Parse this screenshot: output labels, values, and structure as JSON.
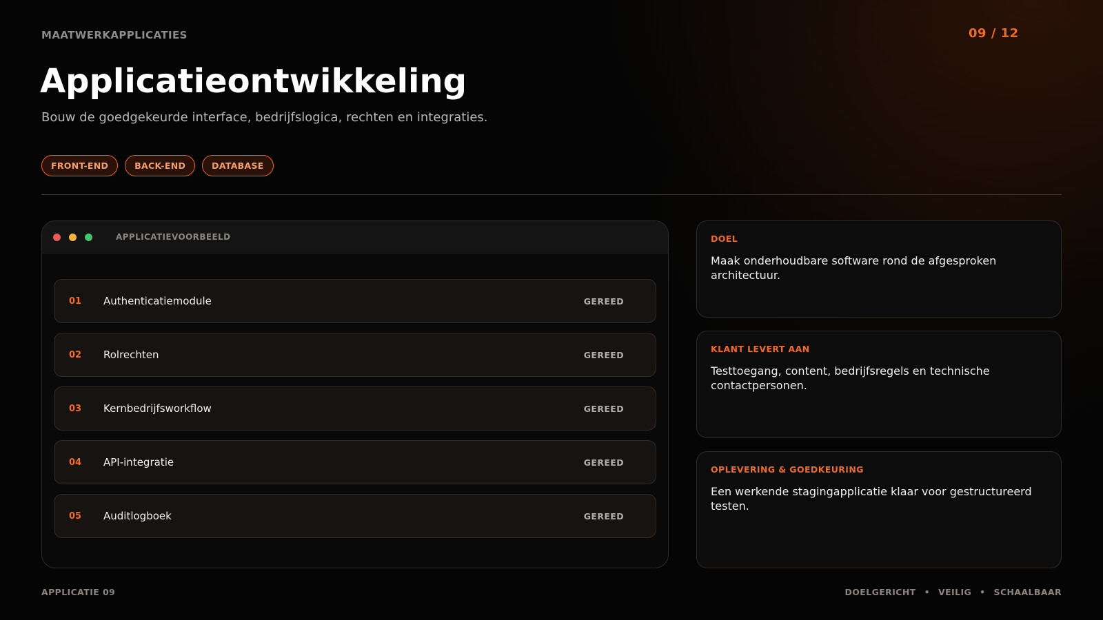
{
  "header": {
    "eyebrow": "MAATWERKAPPLICATIES",
    "page_counter": "09 / 12",
    "title": "Applicatieontwikkeling",
    "subtitle": "Bouw de goedgekeurde interface, bedrijfslogica, rechten en integraties."
  },
  "tags": [
    "FRONT-END",
    "BACK-END",
    "DATABASE"
  ],
  "app_window": {
    "label": "APPLICATIEVOORBEELD",
    "modules": [
      {
        "num": "01",
        "name": "Authenticatiemodule",
        "status": "GEREED"
      },
      {
        "num": "02",
        "name": "Rolrechten",
        "status": "GEREED"
      },
      {
        "num": "03",
        "name": "Kernbedrijfsworkflow",
        "status": "GEREED"
      },
      {
        "num": "04",
        "name": "API-integratie",
        "status": "GEREED"
      },
      {
        "num": "05",
        "name": "Auditlogboek",
        "status": "GEREED"
      }
    ]
  },
  "cards": [
    {
      "title": "DOEL",
      "body": "Maak onderhoudbare software rond de afgesproken architectuur."
    },
    {
      "title": "KLANT LEVERT AAN",
      "body": "Testtoegang, content, bedrijfsregels en technische contactpersonen."
    },
    {
      "title": "OPLEVERING & GOEDKEURING",
      "body": "Een werkende stagingapplicatie klaar voor gestructureerd testen."
    }
  ],
  "footer": {
    "left": "APPLICATIE 09",
    "right": [
      "DOELGERICHT",
      "VEILIG",
      "SCHAALBAAR"
    ],
    "separator": "•"
  },
  "colors": {
    "accent": "#ef6a28",
    "background": "#050505",
    "dot_red": "#ee5a55",
    "dot_yellow": "#f4b33c",
    "dot_green": "#3ec96a"
  }
}
